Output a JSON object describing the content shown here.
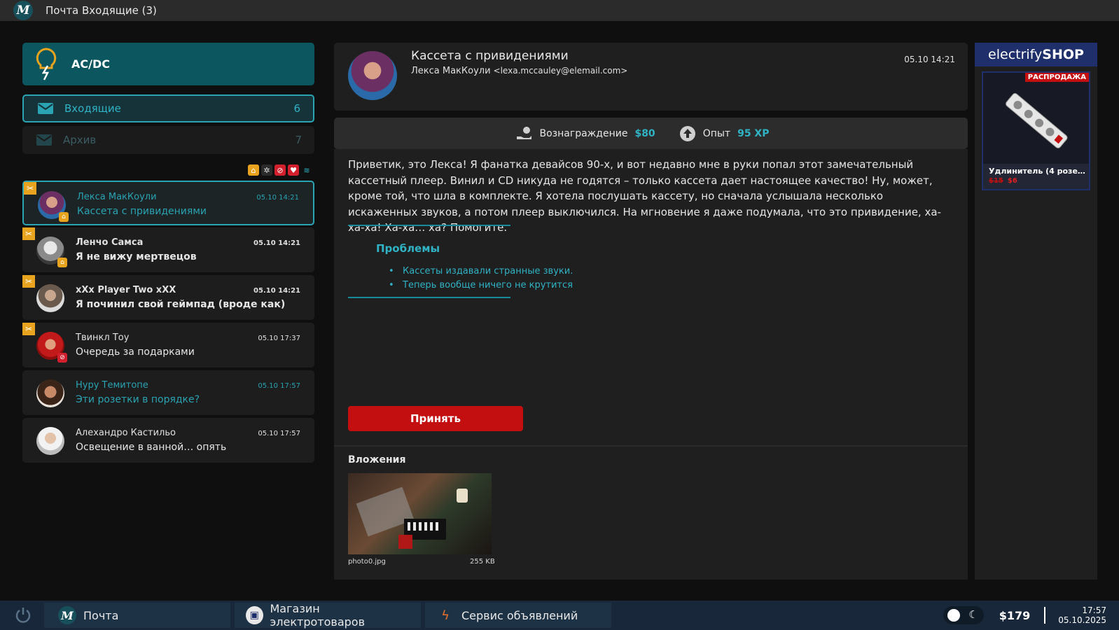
{
  "window": {
    "title": "Почта Входящие (3)",
    "logo_letter": "M"
  },
  "brand": {
    "name": "AC/DC"
  },
  "folders": [
    {
      "label": "Входящие",
      "count": "6"
    },
    {
      "label": "Архив",
      "count": "7"
    }
  ],
  "filter_icons": [
    "shop-icon",
    "gear-icon",
    "no-signal-icon",
    "heart-icon",
    "wifi-icon"
  ],
  "messages": [
    {
      "sender": "Лекса МакКоули",
      "subject": "Кассета с привидениями",
      "time": "05.10 14:21"
    },
    {
      "sender": "Ленчо Самса",
      "subject": "Я не вижу мертвецов",
      "time": "05.10 14:21"
    },
    {
      "sender": "xXx Player Two xXX",
      "subject": "Я починил свой геймпад (вроде как)",
      "time": "05.10 14:21"
    },
    {
      "sender": "Твинкл Тоу",
      "subject": "Очередь за подарками",
      "time": "05.10 17:37"
    },
    {
      "sender": "Нуру Темитопе",
      "subject": "Эти розетки в порядке?",
      "time": "05.10 17:57"
    },
    {
      "sender": "Алехандро Кастильо",
      "subject": "Освещение в ванной… опять",
      "time": "05.10 17:57"
    }
  ],
  "email": {
    "subject": "Кассета с привидениями",
    "from_name": "Лекса МакКоули",
    "from_addr": "<lexa.mccauley@elemail.com>",
    "time": "05.10 14:21",
    "reward_label": "Вознаграждение",
    "reward_value": "$80",
    "xp_label": "Опыт",
    "xp_value": "95 XP",
    "body": "Приветик, это Лекса! Я фанатка девайсов 90-х, и вот недавно мне в руки попал этот замечательный кассетный плеер. Винил и CD никуда не годятся – только кассета дает настоящее качество! Ну, может, кроме той, что шла в комплекте. Я хотела послушать кассету, но сначала услышала несколько искаженных звуков, а потом плеер выключился. На мгновение я даже подумала, что это привидение, ха-ха-ха! Ха-ха… ха? Помогите.",
    "problems_title": "Проблемы",
    "problems": [
      "Кассеты издавали странные звуки.",
      "Теперь вообще ничего не крутится"
    ],
    "accept_label": "Принять",
    "attachments_title": "Вложения",
    "attachment": {
      "name": "photo0.jpg",
      "size": "255 KB"
    }
  },
  "ad": {
    "brand_light": "electrify",
    "brand_bold": "SHOP",
    "sale_label": "РАСПРОДАЖА",
    "product_name": "Удлинитель (4 розе…",
    "old_price": "$15",
    "new_price": "$6"
  },
  "taskbar": {
    "apps": [
      {
        "label": "Почта",
        "icon": "mail-logo-icon"
      },
      {
        "label": "Магазин электротоваров",
        "icon": "shop-bag-icon"
      },
      {
        "label": "Сервис объявлений",
        "icon": "lightning-icon"
      }
    ],
    "money": "$179",
    "time": "17:57",
    "date": "05.10.2025"
  },
  "colors": {
    "accent": "#2aa3b3",
    "brand": "#0c5660",
    "danger": "#c30f0f",
    "taskbar": "#18283a"
  }
}
